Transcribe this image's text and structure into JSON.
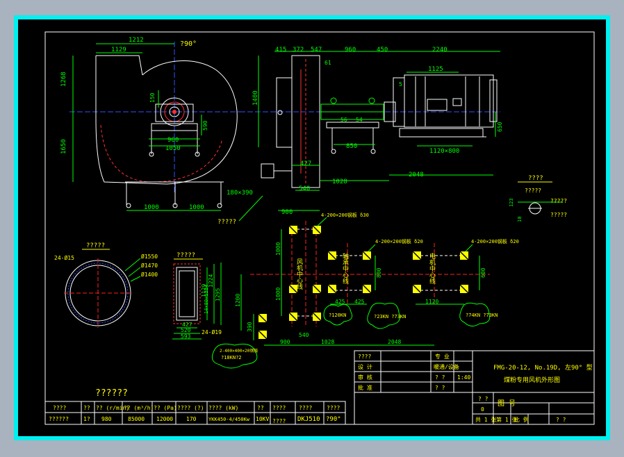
{
  "colors": {
    "background": "#000000",
    "frame": "#00f0f0",
    "line": "#ffffff",
    "dimension": "#00ff00",
    "centerline": "#ff2020",
    "hidden": "#ff3030",
    "text_yellow": "#ffff00",
    "highlight": "#00ff00",
    "axis_blue": "#3050ff"
  },
  "title_block": {
    "title_line1": "FMG-20-12, No.19D, 左90° 型",
    "title_line2": "煤粉专用风机外形图",
    "rows_left": [
      "????",
      "设 计",
      "审 核",
      "批 准"
    ],
    "header_col2": "专 业",
    "col2_values": [
      "暖通/设备",
      "? ?",
      "? ?"
    ],
    "scale": "1:40",
    "drawing_no_label": "图 号",
    "count_label": "? ?",
    "count_value": "0",
    "footer_cells": [
      "共 1 张",
      "第 1 张",
      "比 例",
      "? ?"
    ]
  },
  "params_table": {
    "section_title": "??????",
    "headers": [
      "????",
      "??",
      "?? (r/min)",
      "?? (m³/h)",
      "?? (Pa)",
      "???? (?)",
      "???? (kW)",
      "??",
      "????",
      "????",
      "????"
    ],
    "values": [
      "??????",
      "1?",
      "980",
      "85000",
      "12000",
      "170",
      "YKK450-4/450Kw",
      "10KV",
      "????",
      "DKJ510",
      "?90°"
    ]
  },
  "labels": {
    "rotation": "?90°",
    "dim_1212": "1212",
    "dim_1129": "1129",
    "dim_1268": "1268",
    "dim_1650": "1650",
    "dim_150": "150",
    "dim_590": "590",
    "dim_960": "960",
    "dim_1050": "1050",
    "dim_1000a": "1000",
    "dim_1000b": "1000",
    "side_dims": [
      "415",
      "372",
      "547",
      "960",
      "450",
      "2240"
    ],
    "dim_1125": "1125",
    "dim_1400": "1400",
    "dim_61": "61",
    "dim_5": "5",
    "dim_56": "56",
    "dim_54": "54",
    "dim_850": "850",
    "dim_427": "427",
    "dim_540": "540",
    "dim_1028": "1028",
    "dim_900": "900",
    "dim_2048": "2048",
    "dim_1120x800": "1120×800",
    "dim_650": "650",
    "dim_180x390": "180×390",
    "leader_bottom": "?????",
    "detail_title": "????",
    "detail_labels": [
      "?????",
      "?????",
      "?????"
    ],
    "detail_dims": [
      "123",
      "10"
    ],
    "flange_title": "?????",
    "flange_holes": "24-Ø15",
    "flange_d1": "Ø1550",
    "flange_d2": "Ø1470",
    "flange_d3": "Ø1400",
    "rect_title": "?????",
    "rect_dims": [
      "1129",
      "1224",
      "1295",
      "14×80=1224"
    ],
    "rect_bottom": [
      "427",
      "520",
      "593"
    ],
    "rect_holes": "24-Ø19",
    "base_fan_center": "风机中心线",
    "base_motor_center": "电机中心线",
    "base_bearing_center": "轴承中心线",
    "base_bolts_1": "4-200×200钢板 δ30",
    "base_bolts_2": "4-200×200钢板 δ20",
    "base_bolts_3": "4-200×200钢板 δ20",
    "base_bolts_4": "2-400×400×20钢板",
    "load_1": "?120KN",
    "load_2": "?23KN ?73KN",
    "load_3": "?74KN ?73KN",
    "load_4": "?18KN?2",
    "base_dims": [
      "1000",
      "1000",
      "1200",
      "800",
      "600",
      "425",
      "425",
      "1120",
      "390",
      "900",
      "540",
      "1028",
      "2048"
    ]
  }
}
